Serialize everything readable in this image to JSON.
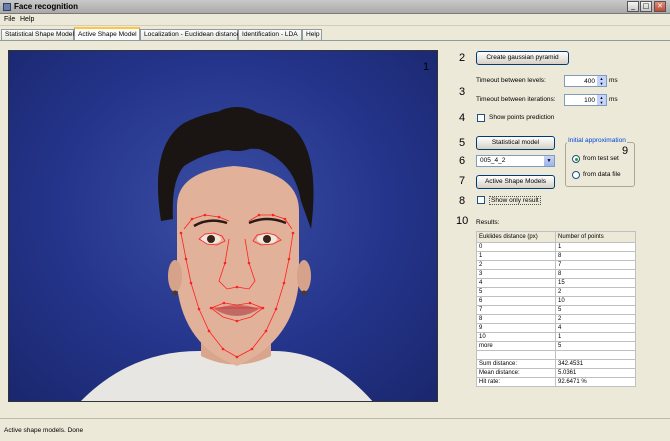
{
  "window": {
    "title": "Face recognition",
    "min": "_",
    "max": "□",
    "close": "✕"
  },
  "menu": [
    "File",
    "Help"
  ],
  "tabs": [
    "Statistical Shape Model",
    "Active Shape Model",
    "Localization - Euclidean distance",
    "Identification - LDA",
    "Help"
  ],
  "active_tab": "Active Shape Model",
  "annotations": [
    "1",
    "2",
    "3",
    "4",
    "5",
    "6",
    "7",
    "8",
    "9",
    "10"
  ],
  "controls": {
    "pyramid_button": "Create gaussian pyramid",
    "timeout_levels_label": "Timeout between levels:",
    "timeout_levels_value": "400",
    "timeout_iter_label": "Timeout between iterations:",
    "timeout_iter_value": "100",
    "unit": "ms",
    "show_points_label": "Show points prediction",
    "statistical_model_button": "Statistical model",
    "model_select_value": "005_4_2",
    "asm_button": "Active Shape Models",
    "show_only_label": "Show only result",
    "approx_title": "Initial approximation",
    "approx_test": "from test set",
    "approx_file": "from data file"
  },
  "results": {
    "title": "Results:",
    "headers": [
      "Euklides distance (px)",
      "Number of points"
    ],
    "rows": [
      [
        "0",
        "1"
      ],
      [
        "1",
        "8"
      ],
      [
        "2",
        "7"
      ],
      [
        "3",
        "8"
      ],
      [
        "4",
        "15"
      ],
      [
        "5",
        "2"
      ],
      [
        "6",
        "10"
      ],
      [
        "7",
        "5"
      ],
      [
        "8",
        "2"
      ],
      [
        "9",
        "4"
      ],
      [
        "10",
        "1"
      ],
      [
        "more",
        "5"
      ]
    ],
    "summary": [
      [
        "Sum distance:",
        "342.4531"
      ],
      [
        "Mean distance:",
        "5.0361"
      ],
      [
        "Hit rate:",
        "92.6471 %"
      ]
    ]
  },
  "status": "Active shape models. Done"
}
